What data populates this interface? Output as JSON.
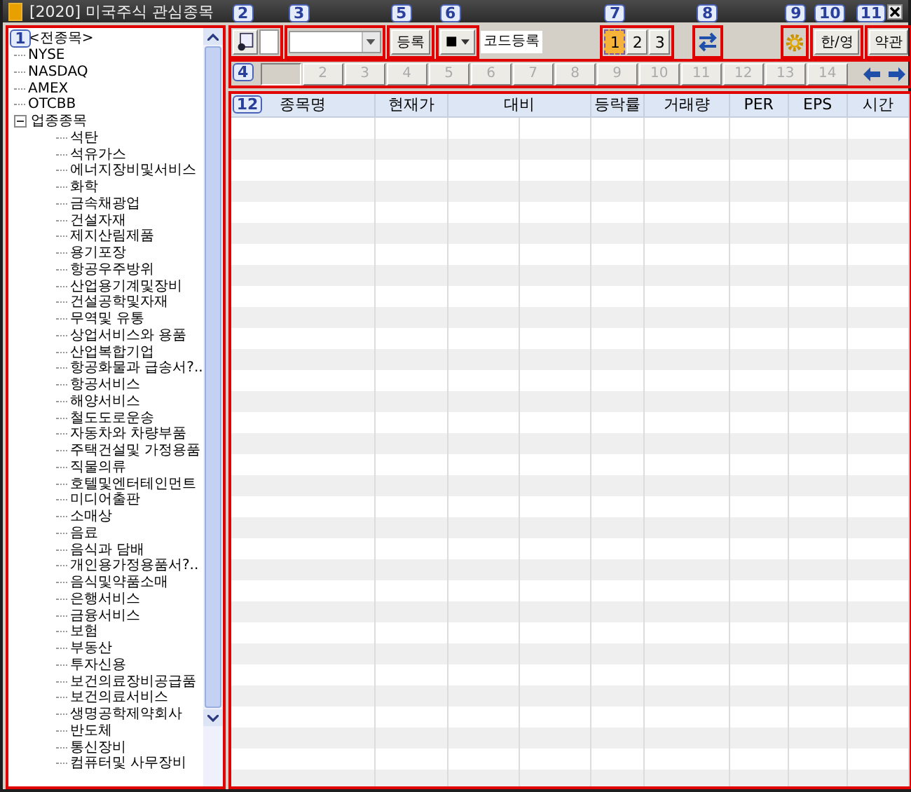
{
  "window": {
    "title": "[2020] 미국주식 관심종목"
  },
  "tree": {
    "callout": "1",
    "items": [
      {
        "label": "<전종목>"
      },
      {
        "label": "NYSE"
      },
      {
        "label": "NASDAQ"
      },
      {
        "label": "AMEX"
      },
      {
        "label": "OTCBB"
      },
      {
        "label": "업종종목",
        "expanded": true,
        "children": [
          {
            "label": "석탄"
          },
          {
            "label": "석유가스"
          },
          {
            "label": "에너지장비및서비스"
          },
          {
            "label": "화학"
          },
          {
            "label": "금속채광업"
          },
          {
            "label": "건설자재"
          },
          {
            "label": "제지산림제품"
          },
          {
            "label": "용기포장"
          },
          {
            "label": "항공우주방위"
          },
          {
            "label": "산업용기계및장비"
          },
          {
            "label": "건설공학및자재"
          },
          {
            "label": "무역및 유통"
          },
          {
            "label": "상업서비스와 용품"
          },
          {
            "label": "산업복합기업"
          },
          {
            "label": "항공화물과 급송서?.."
          },
          {
            "label": "항공서비스"
          },
          {
            "label": "해양서비스"
          },
          {
            "label": "철도도로운송"
          },
          {
            "label": "자동차와 차량부품"
          },
          {
            "label": "주택건설및 가정용품"
          },
          {
            "label": "직물의류"
          },
          {
            "label": "호텔및엔터테인먼트"
          },
          {
            "label": "미디어출판"
          },
          {
            "label": "소매상"
          },
          {
            "label": "음료"
          },
          {
            "label": "음식과 담배"
          },
          {
            "label": "개인용가정용품서?.."
          },
          {
            "label": "음식및약품소매"
          },
          {
            "label": "은행서비스"
          },
          {
            "label": "금융서비스"
          },
          {
            "label": "보험"
          },
          {
            "label": "부동산"
          },
          {
            "label": "투자신용"
          },
          {
            "label": "보건의료장비공급품"
          },
          {
            "label": "보건의료서비스"
          },
          {
            "label": "생명공학제약회사"
          },
          {
            "label": "반도체"
          },
          {
            "label": "통신장비"
          },
          {
            "label": "컴퓨터및 사무장비"
          }
        ]
      }
    ]
  },
  "toolbar": [
    {
      "kind": "open",
      "callout": "2"
    },
    {
      "kind": "combo",
      "callout": "3"
    },
    {
      "kind": "button",
      "label": "등록",
      "callout": "5"
    },
    {
      "kind": "dropdown",
      "label": "■",
      "callout": "6"
    },
    {
      "kind": "field",
      "label": "코드등록"
    },
    {
      "kind": "pages",
      "callout": "7",
      "items": [
        {
          "label": "1",
          "selected": true
        },
        {
          "label": "2",
          "selected": false
        },
        {
          "label": "3",
          "selected": false
        }
      ]
    },
    {
      "kind": "swap",
      "callout": "8"
    },
    {
      "kind": "gear",
      "callout": "9"
    },
    {
      "kind": "button",
      "label": "한/영",
      "callout": "10"
    },
    {
      "kind": "button",
      "label": "약관",
      "callout": "11"
    }
  ],
  "page_tabs": {
    "callout": "4",
    "items": [
      {
        "selected": true
      },
      {
        "label": "2",
        "selected": false
      },
      {
        "label": "3",
        "selected": false
      },
      {
        "label": "4",
        "selected": false
      },
      {
        "label": "5",
        "selected": false
      },
      {
        "label": "6",
        "selected": false
      },
      {
        "label": "7",
        "selected": false
      },
      {
        "label": "8",
        "selected": false
      },
      {
        "label": "9",
        "selected": false
      },
      {
        "label": "10",
        "selected": false
      },
      {
        "label": "11",
        "selected": false
      },
      {
        "label": "12",
        "selected": false
      },
      {
        "label": "13",
        "selected": false
      },
      {
        "label": "14",
        "selected": false
      }
    ]
  },
  "table": {
    "callout": "12",
    "columns": [
      {
        "label": "종목명"
      },
      {
        "label": "현재가"
      },
      {
        "label": "대비",
        "split": true
      },
      {
        "label": "등락률"
      },
      {
        "label": "거래량"
      },
      {
        "label": "PER"
      },
      {
        "label": "EPS"
      },
      {
        "label": "시간"
      }
    ]
  }
}
